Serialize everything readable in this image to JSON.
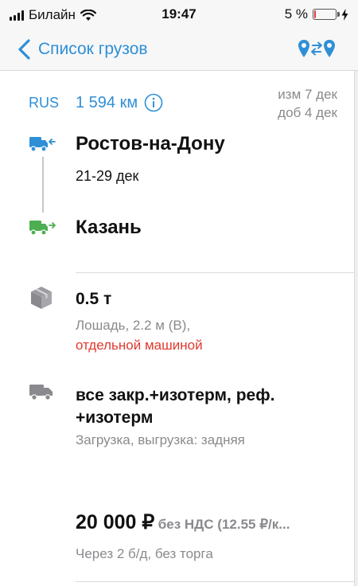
{
  "status_bar": {
    "carrier": "Билайн",
    "time": "19:47",
    "battery_percent": "5 %",
    "battery_level": 0.05,
    "battery_color": "#e53935"
  },
  "nav": {
    "back_label": "Список грузов",
    "back_icon": "chevron-left-icon",
    "route_icon": "route-map-pins-icon"
  },
  "cargo": {
    "country": "RUS",
    "distance": "1 594 км",
    "changed": "изм 7 дек",
    "added": "доб 4 дек",
    "from_city": "Ростов-на-Дону",
    "date_range": "21-29 дек",
    "to_city": "Казань",
    "weight": "0.5 т",
    "cargo_desc": "Лошадь, 2.2 м (В),",
    "transport_mode": "отдельной машиной",
    "body_type": "все закр.+изотерм, реф. +изотерм",
    "loading": "Загрузка, выгрузка: задняя",
    "price": "20 000 ₽",
    "price_note": "без НДС (12.55 ₽/к...",
    "payment_terms": "Через 2 б/д, без торга"
  },
  "colors": {
    "accent": "#2f8fd6",
    "loading_truck": "#2f8fd6",
    "unloading_truck": "#4caf50",
    "warning_text": "#e03a2f",
    "muted_text": "#8a8a8e"
  }
}
